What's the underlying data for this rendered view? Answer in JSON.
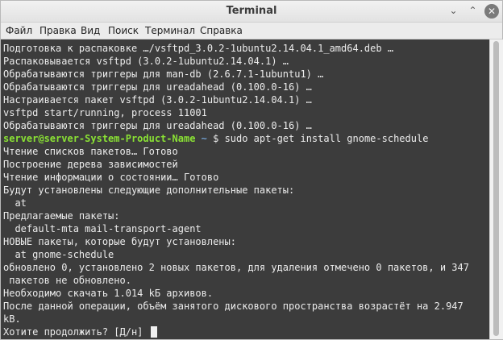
{
  "window": {
    "title": "Terminal",
    "controls": {
      "minimize": "⌄",
      "maximize": "⌃",
      "close": "✕"
    }
  },
  "menu": [
    "Файл",
    "Правка",
    "Вид",
    "Поиск",
    "Терминал",
    "Справка"
  ],
  "terminal": {
    "lines": [
      "Подготовка к распаковке …/vsftpd_3.0.2-1ubuntu2.14.04.1_amd64.deb …",
      "Распаковывается vsftpd (3.0.2-1ubuntu2.14.04.1) …",
      "Обрабатываются триггеры для man-db (2.6.7.1-1ubuntu1) …",
      "Обрабатываются триггеры для ureadahead (0.100.0-16) …",
      "Настраивается пакет vsftpd (3.0.2-1ubuntu2.14.04.1) …",
      "vsftpd start/running, process 11001",
      "Обрабатываются триггеры для ureadahead (0.100.0-16) …",
      "",
      "Чтение списков пакетов… Готово",
      "Построение дерева зависимостей",
      "Чтение информации о состоянии… Готово",
      "Будут установлены следующие дополнительные пакеты:",
      "  at",
      "Предлагаемые пакеты:",
      "  default-mta mail-transport-agent",
      "НОВЫЕ пакеты, которые будут установлены:",
      "  at gnome-schedule",
      "обновлено 0, установлено 2 новых пакетов, для удаления отмечено 0 пакетов, и 347",
      " пакетов не обновлено.",
      "Необходимо скачать 1.014 kБ архивов.",
      "После данной операции, объём занятого дискового пространства возрастёт на 2.947",
      "kB.",
      "Хотите продолжить? [Д/н] "
    ],
    "prompt": {
      "user_host": "server@server-System-Product-Name",
      "path": " ~",
      "symbol": " $ ",
      "command": "sudo apt-get install gnome-schedule"
    }
  }
}
